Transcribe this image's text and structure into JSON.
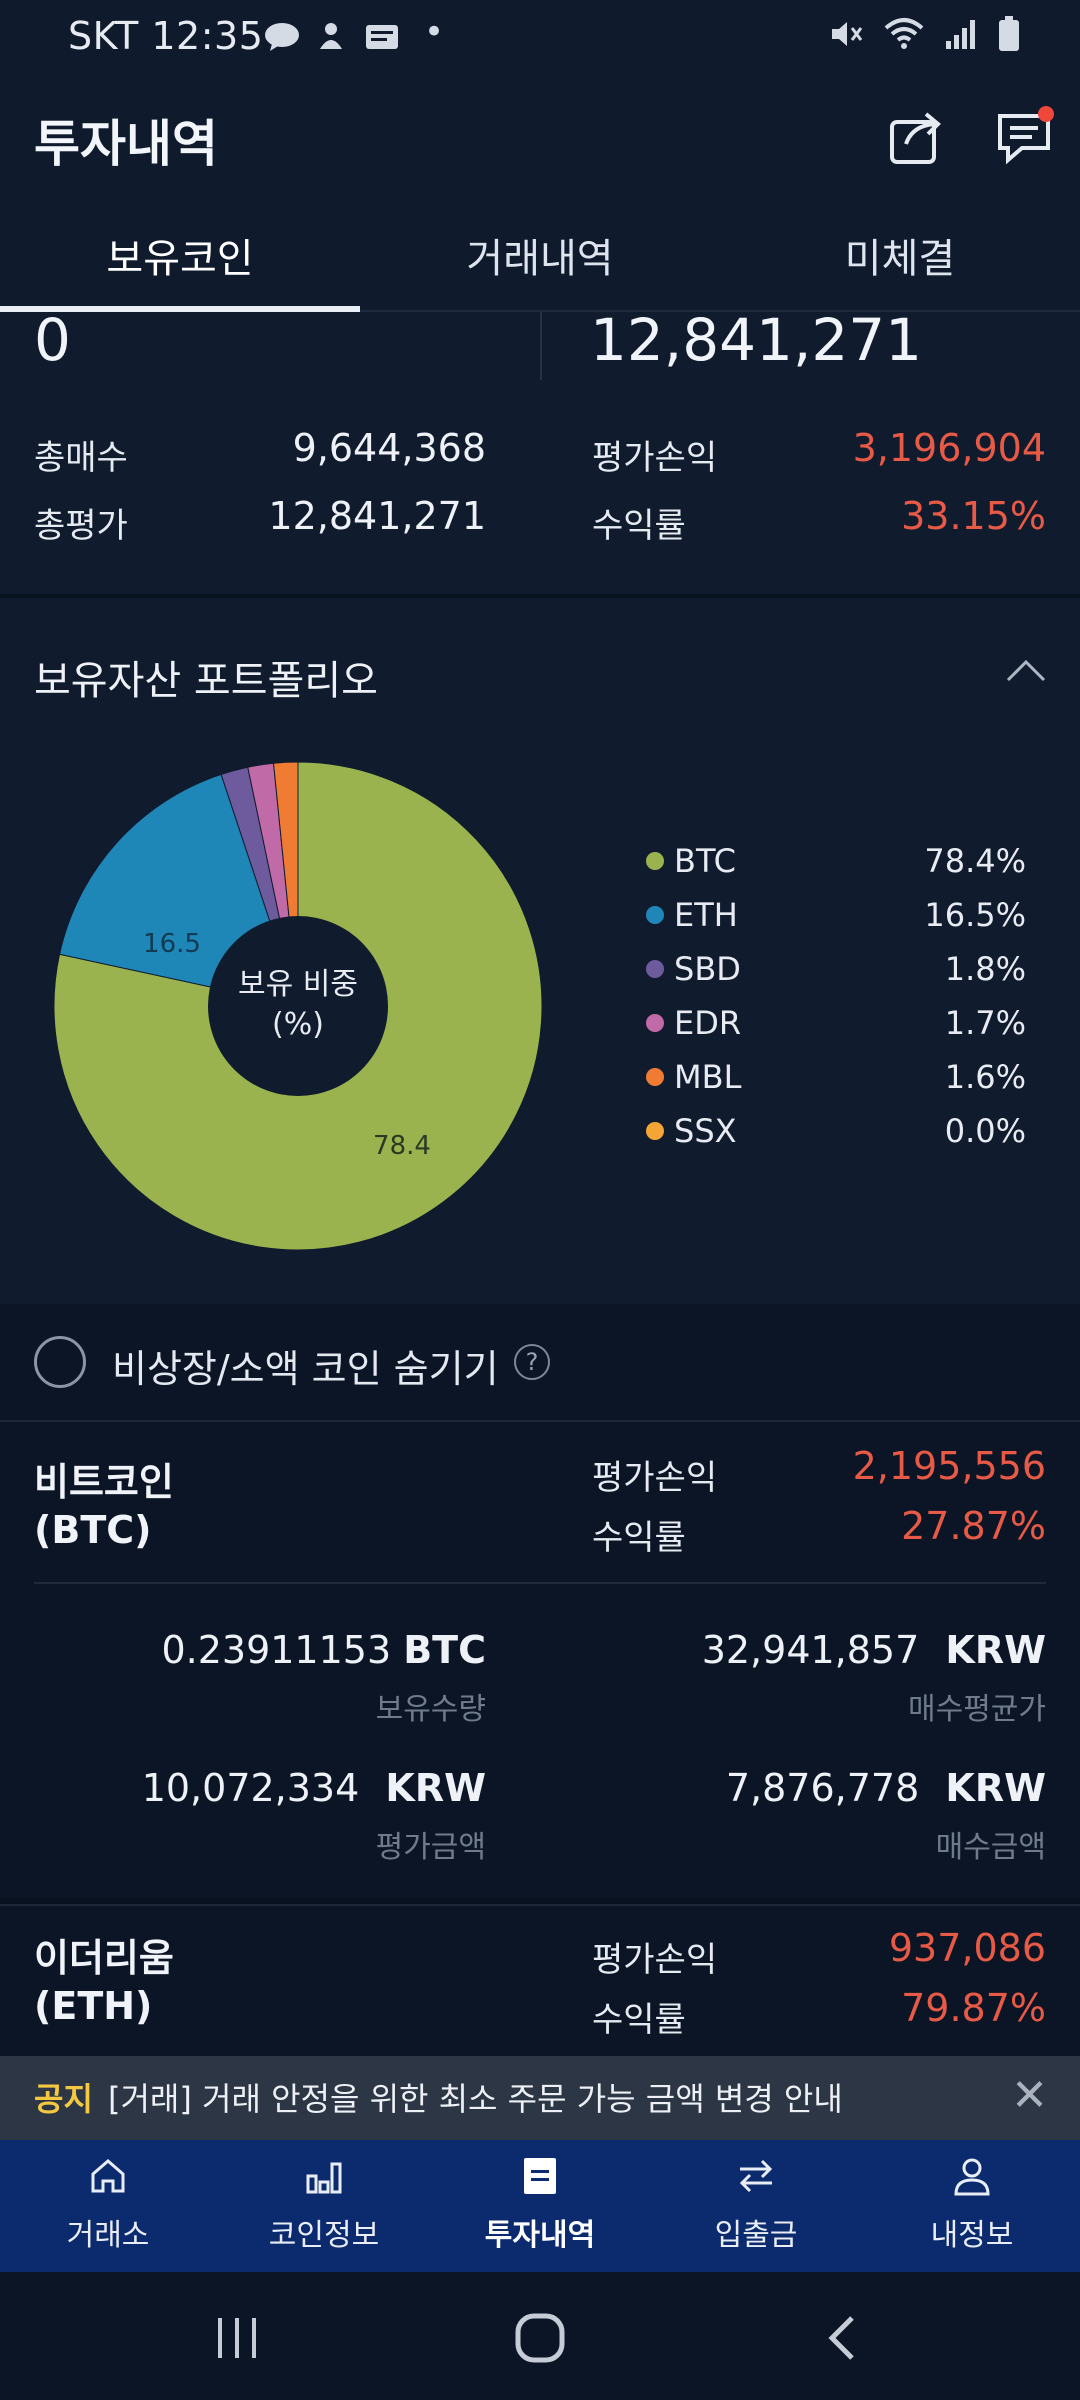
{
  "status_bar": {
    "carrier_time": "SKT 12:35",
    "notification_icons": [
      "talk-icon",
      "bell-icon",
      "ge-icon"
    ],
    "dot": "•"
  },
  "header": {
    "title": "투자내역"
  },
  "tabs": [
    {
      "label": "보유코인",
      "active": true
    },
    {
      "label": "거래내역",
      "active": false
    },
    {
      "label": "미체결",
      "active": false
    }
  ],
  "summary": {
    "top_left_value": "0",
    "top_right_value": "12,841,271",
    "total_buy_label": "총매수",
    "total_buy_value": "9,644,368",
    "total_eval_label": "총평가",
    "total_eval_value": "12,841,271",
    "eval_pl_label": "평가손익",
    "eval_pl_value": "3,196,904",
    "return_label": "수익률",
    "return_value": "33.15%"
  },
  "portfolio": {
    "title": "보유자산 포트폴리오",
    "center_label_line1": "보유 비중",
    "center_label_line2": "(%)",
    "slice_label_btc": "78.4",
    "slice_label_eth": "16.5"
  },
  "chart_data": {
    "type": "pie",
    "donut": true,
    "categories": [
      "BTC",
      "ETH",
      "SBD",
      "EDR",
      "MBL",
      "SSX"
    ],
    "values": [
      78.4,
      16.5,
      1.8,
      1.7,
      1.6,
      0.0
    ],
    "labels_pct": [
      "78.4%",
      "16.5%",
      "1.8%",
      "1.7%",
      "1.6%",
      "0.0%"
    ],
    "colors": [
      "#9bb34e",
      "#1f86b8",
      "#6e5b9e",
      "#c16aa8",
      "#f07c34",
      "#f4a535"
    ],
    "legend_position": "right"
  },
  "hide_toggle": {
    "label": "비상장/소액 코인 숨기기",
    "help": "?"
  },
  "coins": [
    {
      "name_line1": "비트코인",
      "name_line2": "(BTC)",
      "eval_pl_label": "평가손익",
      "eval_pl_value": "2,195,556",
      "return_label": "수익률",
      "return_value": "27.87%",
      "holding_amount": "0.23911153",
      "holding_unit": "BTC",
      "holding_label": "보유수량",
      "avg_price": "32,941,857",
      "avg_price_unit": "KRW",
      "avg_price_label": "매수평균가",
      "eval_amount": "10,072,334",
      "eval_amount_unit": "KRW",
      "eval_amount_label": "평가금액",
      "buy_amount": "7,876,778",
      "buy_amount_unit": "KRW",
      "buy_amount_label": "매수금액"
    },
    {
      "name_line1": "이더리움",
      "name_line2": "(ETH)",
      "eval_pl_label": "평가손익",
      "eval_pl_value": "937,086",
      "return_label": "수익률",
      "return_value": "79.87%"
    }
  ],
  "notice": {
    "tag": "공지",
    "text": "[거래] 거래 안정을 위한 최소 주문 가능 금액 변경 안내",
    "close": "✕"
  },
  "bottom_nav": [
    {
      "label": "거래소",
      "icon": "home-icon"
    },
    {
      "label": "코인정보",
      "icon": "bar-chart-icon"
    },
    {
      "label": "투자내역",
      "icon": "list-icon",
      "active": true
    },
    {
      "label": "입출금",
      "icon": "transfer-icon"
    },
    {
      "label": "내정보",
      "icon": "user-icon"
    }
  ],
  "colors": {
    "background": "#0b1526",
    "panel": "#101c2e",
    "loss_gain_red": "#e85a45",
    "notice_yellow": "#f5c842",
    "bottom_nav": "#0c2a6e"
  }
}
